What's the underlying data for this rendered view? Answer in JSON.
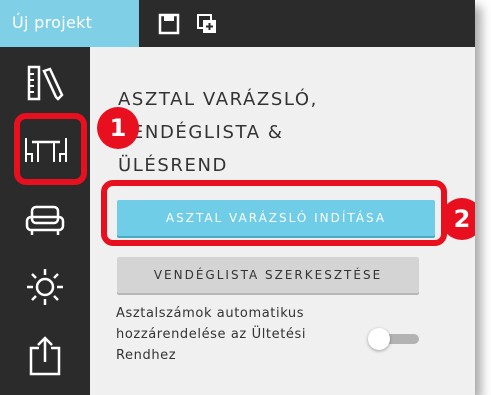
{
  "topbar": {
    "active_tab_label": "Új projekt",
    "icons": [
      "save-icon",
      "duplicate-icon"
    ]
  },
  "sidebar": {
    "items": [
      {
        "icon": "ruler-pencil-icon"
      },
      {
        "icon": "table-chairs-icon"
      },
      {
        "icon": "armchair-icon"
      },
      {
        "icon": "sun-icon"
      },
      {
        "icon": "export-icon"
      }
    ]
  },
  "content": {
    "heading_lines": [
      "ASZTAL VARÁZSLÓ,",
      "VENDÉGLISTA &",
      "ÜLÉSREND"
    ],
    "wizard_button": "ASZTAL VARÁZSLÓ INDÍTÁSA",
    "guestlist_button": "VENDÉGLISTA SZERKESZTÉSE",
    "auto_numbering_lines": [
      "Asztalszámok automatikus",
      "hozzárendelése az Ültetési",
      "Rendhez"
    ],
    "auto_numbering_enabled": false
  },
  "callouts": [
    "1",
    "2"
  ],
  "colors": {
    "accent": "#6fcde8",
    "dark": "#2b2b2b",
    "callout": "#e8101e"
  }
}
